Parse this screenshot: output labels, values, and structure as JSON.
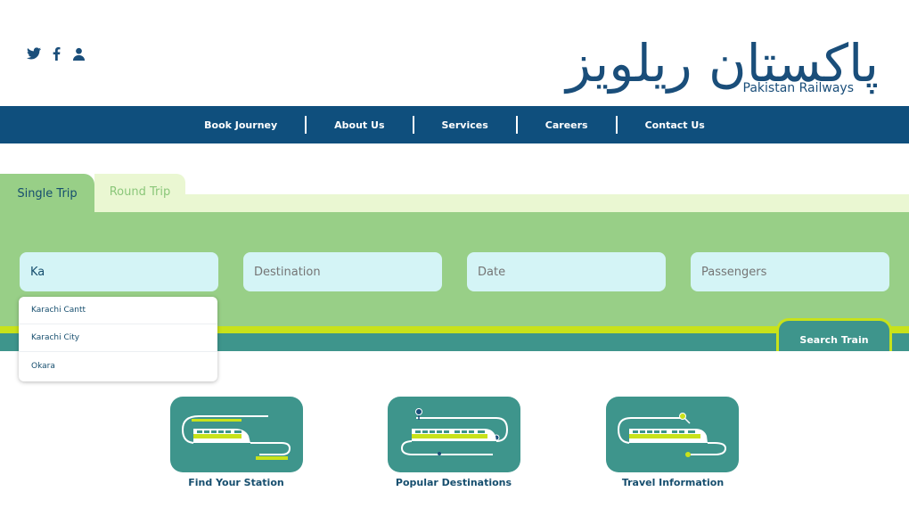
{
  "header": {
    "logo_urdu": "پاکستان ریلویز",
    "logo_english": "Pakistan Railways",
    "social": [
      "twitter-icon",
      "facebook-icon",
      "user-icon"
    ]
  },
  "nav": {
    "items": [
      "Book Journey",
      "About Us",
      "Services",
      "Careers",
      "Contact Us"
    ]
  },
  "booking": {
    "tabs": [
      "Single Trip",
      "Round Trip"
    ],
    "active_tab": "Single Trip",
    "origin_value": "Ka",
    "destination_placeholder": "Destination",
    "date_placeholder": "Date",
    "passengers_placeholder": "Passengers",
    "search_label": "Search Train",
    "suggestions": [
      "Karachi Cantt",
      "Karachi City",
      "Okara"
    ]
  },
  "features": [
    {
      "label": "Find Your Station",
      "icon": "station-train-icon"
    },
    {
      "label": "Popular Destinations",
      "icon": "destinations-train-icon"
    },
    {
      "label": "Travel Information",
      "icon": "travel-info-train-icon"
    }
  ],
  "colors": {
    "navy": "#0f4f7d",
    "green_panel": "#98cf87",
    "light_green": "#eaf7d2",
    "field_bg": "#d4f4f6",
    "lime": "#c8e21a",
    "teal": "#3e958c",
    "text_dark": "#164e6e"
  }
}
